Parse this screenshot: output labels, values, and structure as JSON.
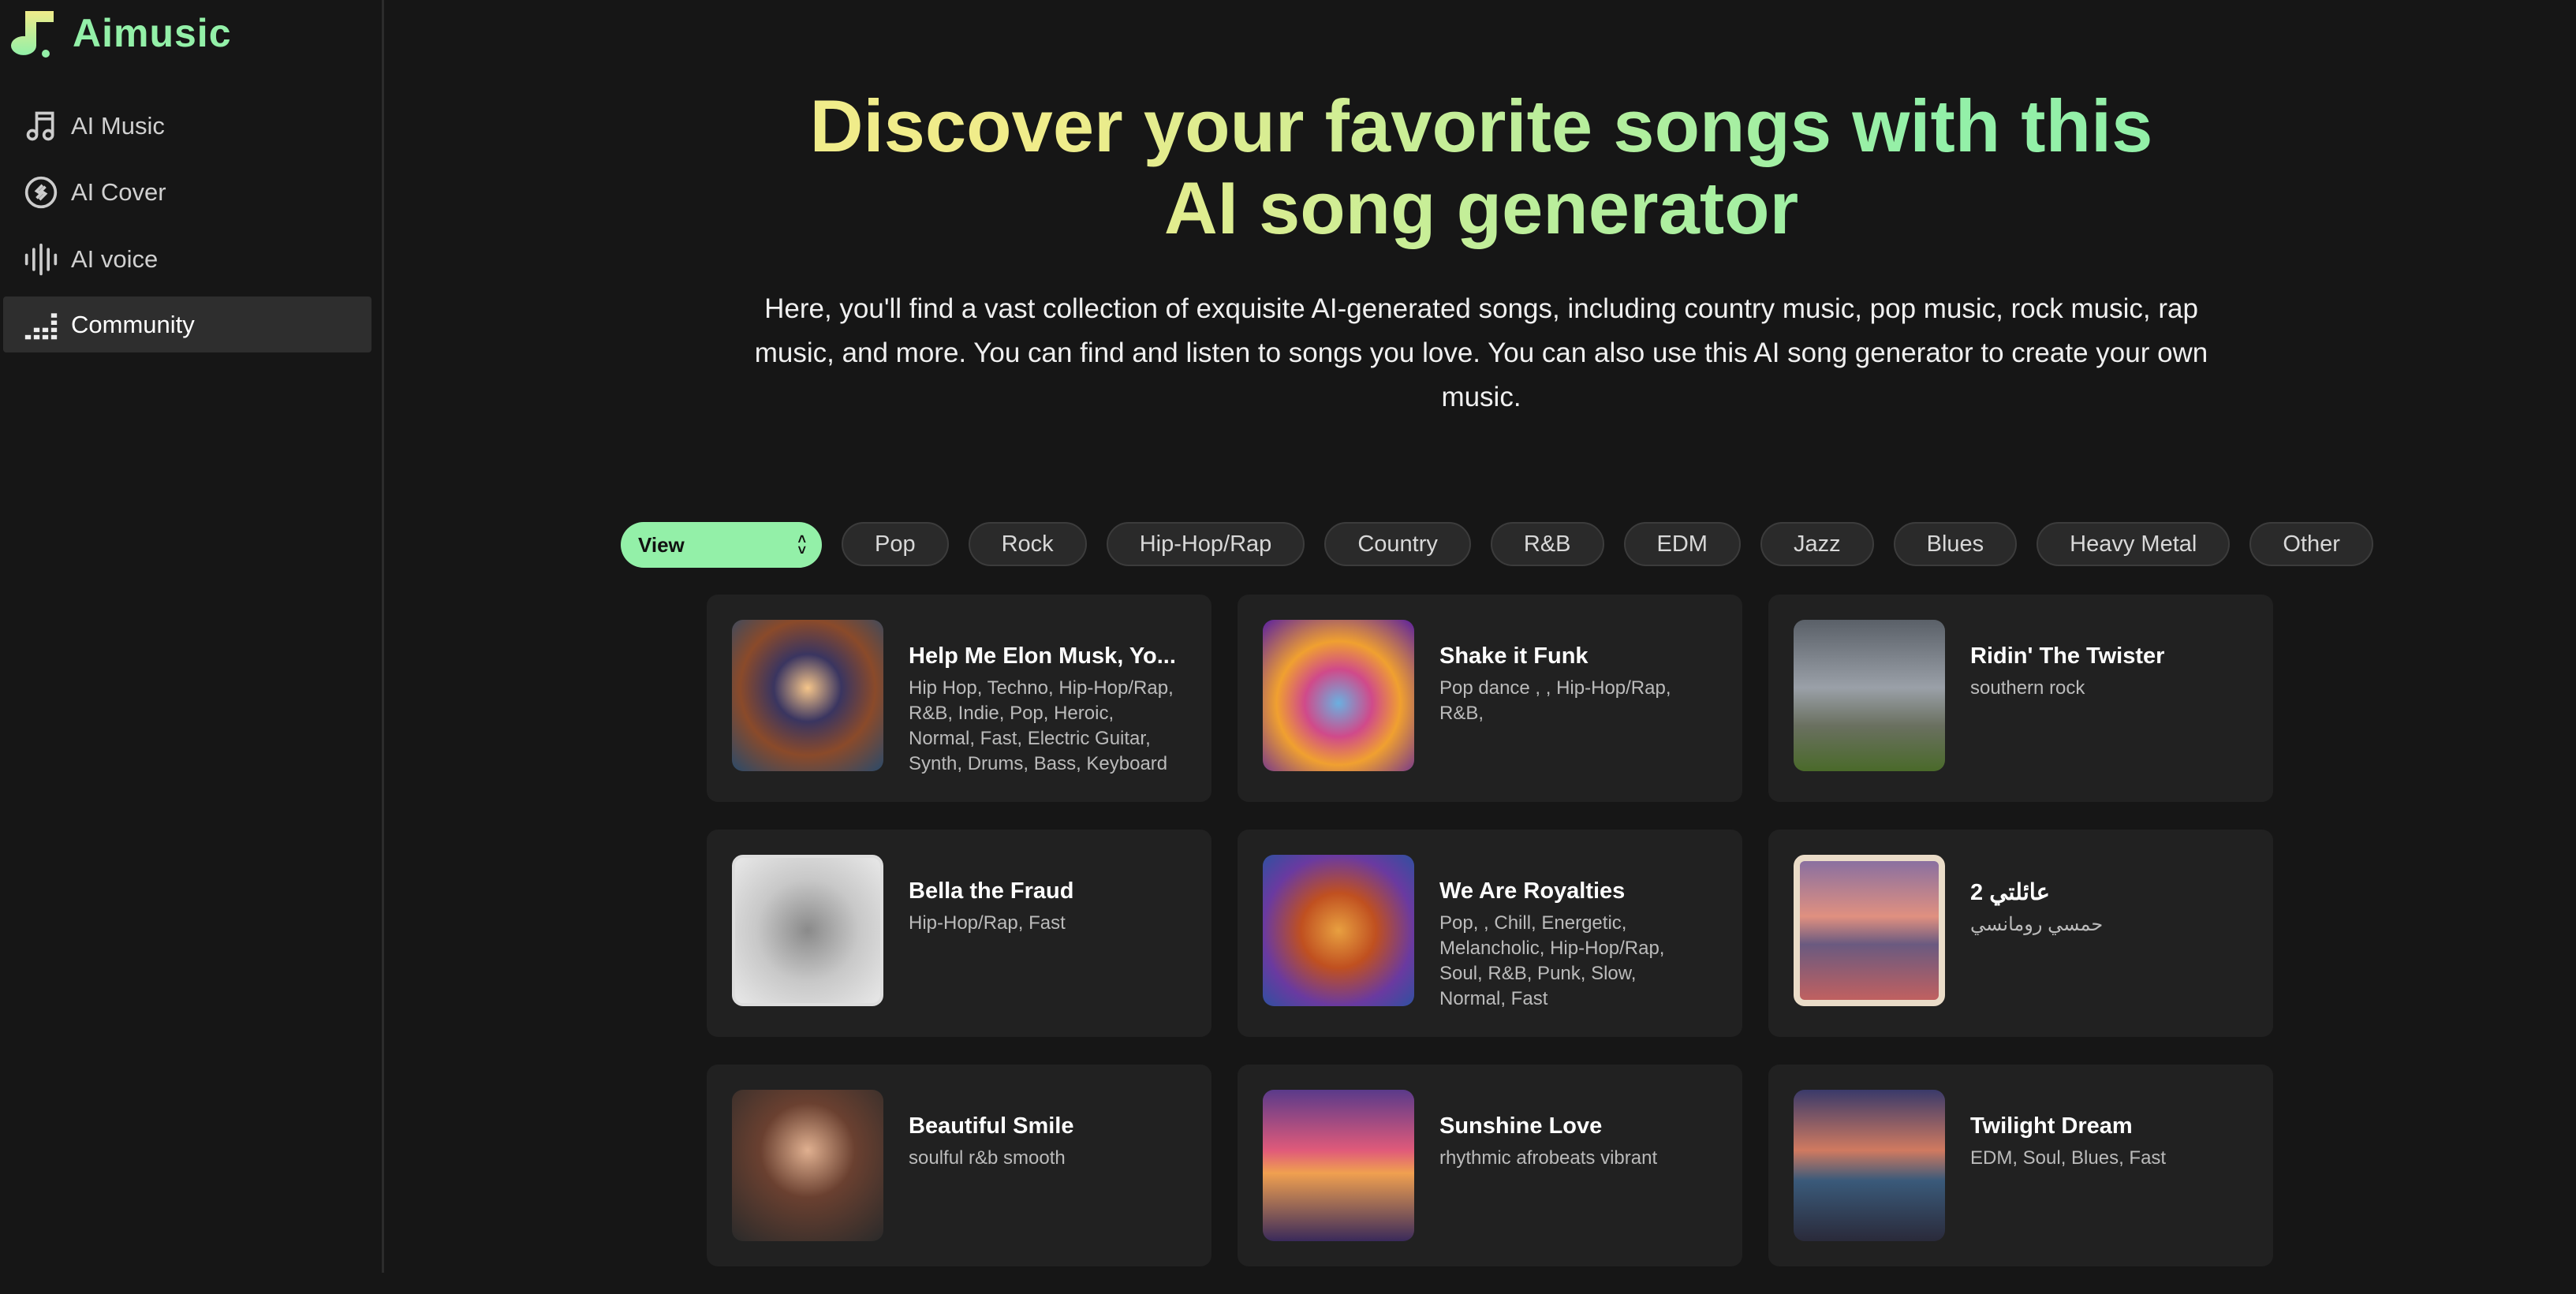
{
  "brand": {
    "name": "Aimusic",
    "accent": "#93f0a8",
    "accent2": "#f0ec8a"
  },
  "sidebar": {
    "items": [
      {
        "label": "AI Music",
        "icon": "music-notes-icon"
      },
      {
        "label": "AI Cover",
        "icon": "cover-icon"
      },
      {
        "label": "AI voice",
        "icon": "waveform-icon"
      },
      {
        "label": "Community",
        "icon": "equalizer-icon",
        "active": true
      }
    ]
  },
  "hero": {
    "title": "Discover your favorite songs with this AI song generator",
    "description": "Here, you'll find a vast collection of exquisite AI-generated songs, including country music, pop music, rock music, rap music, and more. You can find and listen to songs you love. You can also use this AI song generator to create your own music."
  },
  "filters": {
    "select_value": "View",
    "genres": [
      "Pop",
      "Rock",
      "Hip-Hop/Rap",
      "Country",
      "R&B",
      "EDM",
      "Jazz",
      "Blues",
      "Heavy Metal",
      "Other"
    ]
  },
  "songs": [
    {
      "title": "Help Me Elon Musk, Yo...",
      "tags": "Hip Hop, Techno, Hip-Hop/Rap, R&B, Indie, Pop, Heroic, Normal, Fast, Electric Guitar, Synth, Drums, Bass, Keyboard"
    },
    {
      "title": "Shake it Funk",
      "tags": "Pop dance , , Hip-Hop/Rap, R&B,"
    },
    {
      "title": "Ridin' The Twister",
      "tags": "southern rock"
    },
    {
      "title": "Bella the Fraud",
      "tags": "Hip-Hop/Rap, Fast"
    },
    {
      "title": "We Are Royalties",
      "tags": "Pop, , Chill, Energetic, Melancholic, Hip-Hop/Rap, Soul, R&B, Punk, Slow, Normal, Fast"
    },
    {
      "title": "عائلتي 2",
      "tags": "حمسي رومانسي"
    },
    {
      "title": "Beautiful Smile",
      "tags": "soulful r&b smooth"
    },
    {
      "title": "Sunshine Love",
      "tags": "rhythmic afrobeats vibrant"
    },
    {
      "title": "Twilight Dream",
      "tags": "EDM, Soul, Blues, Fast"
    }
  ]
}
